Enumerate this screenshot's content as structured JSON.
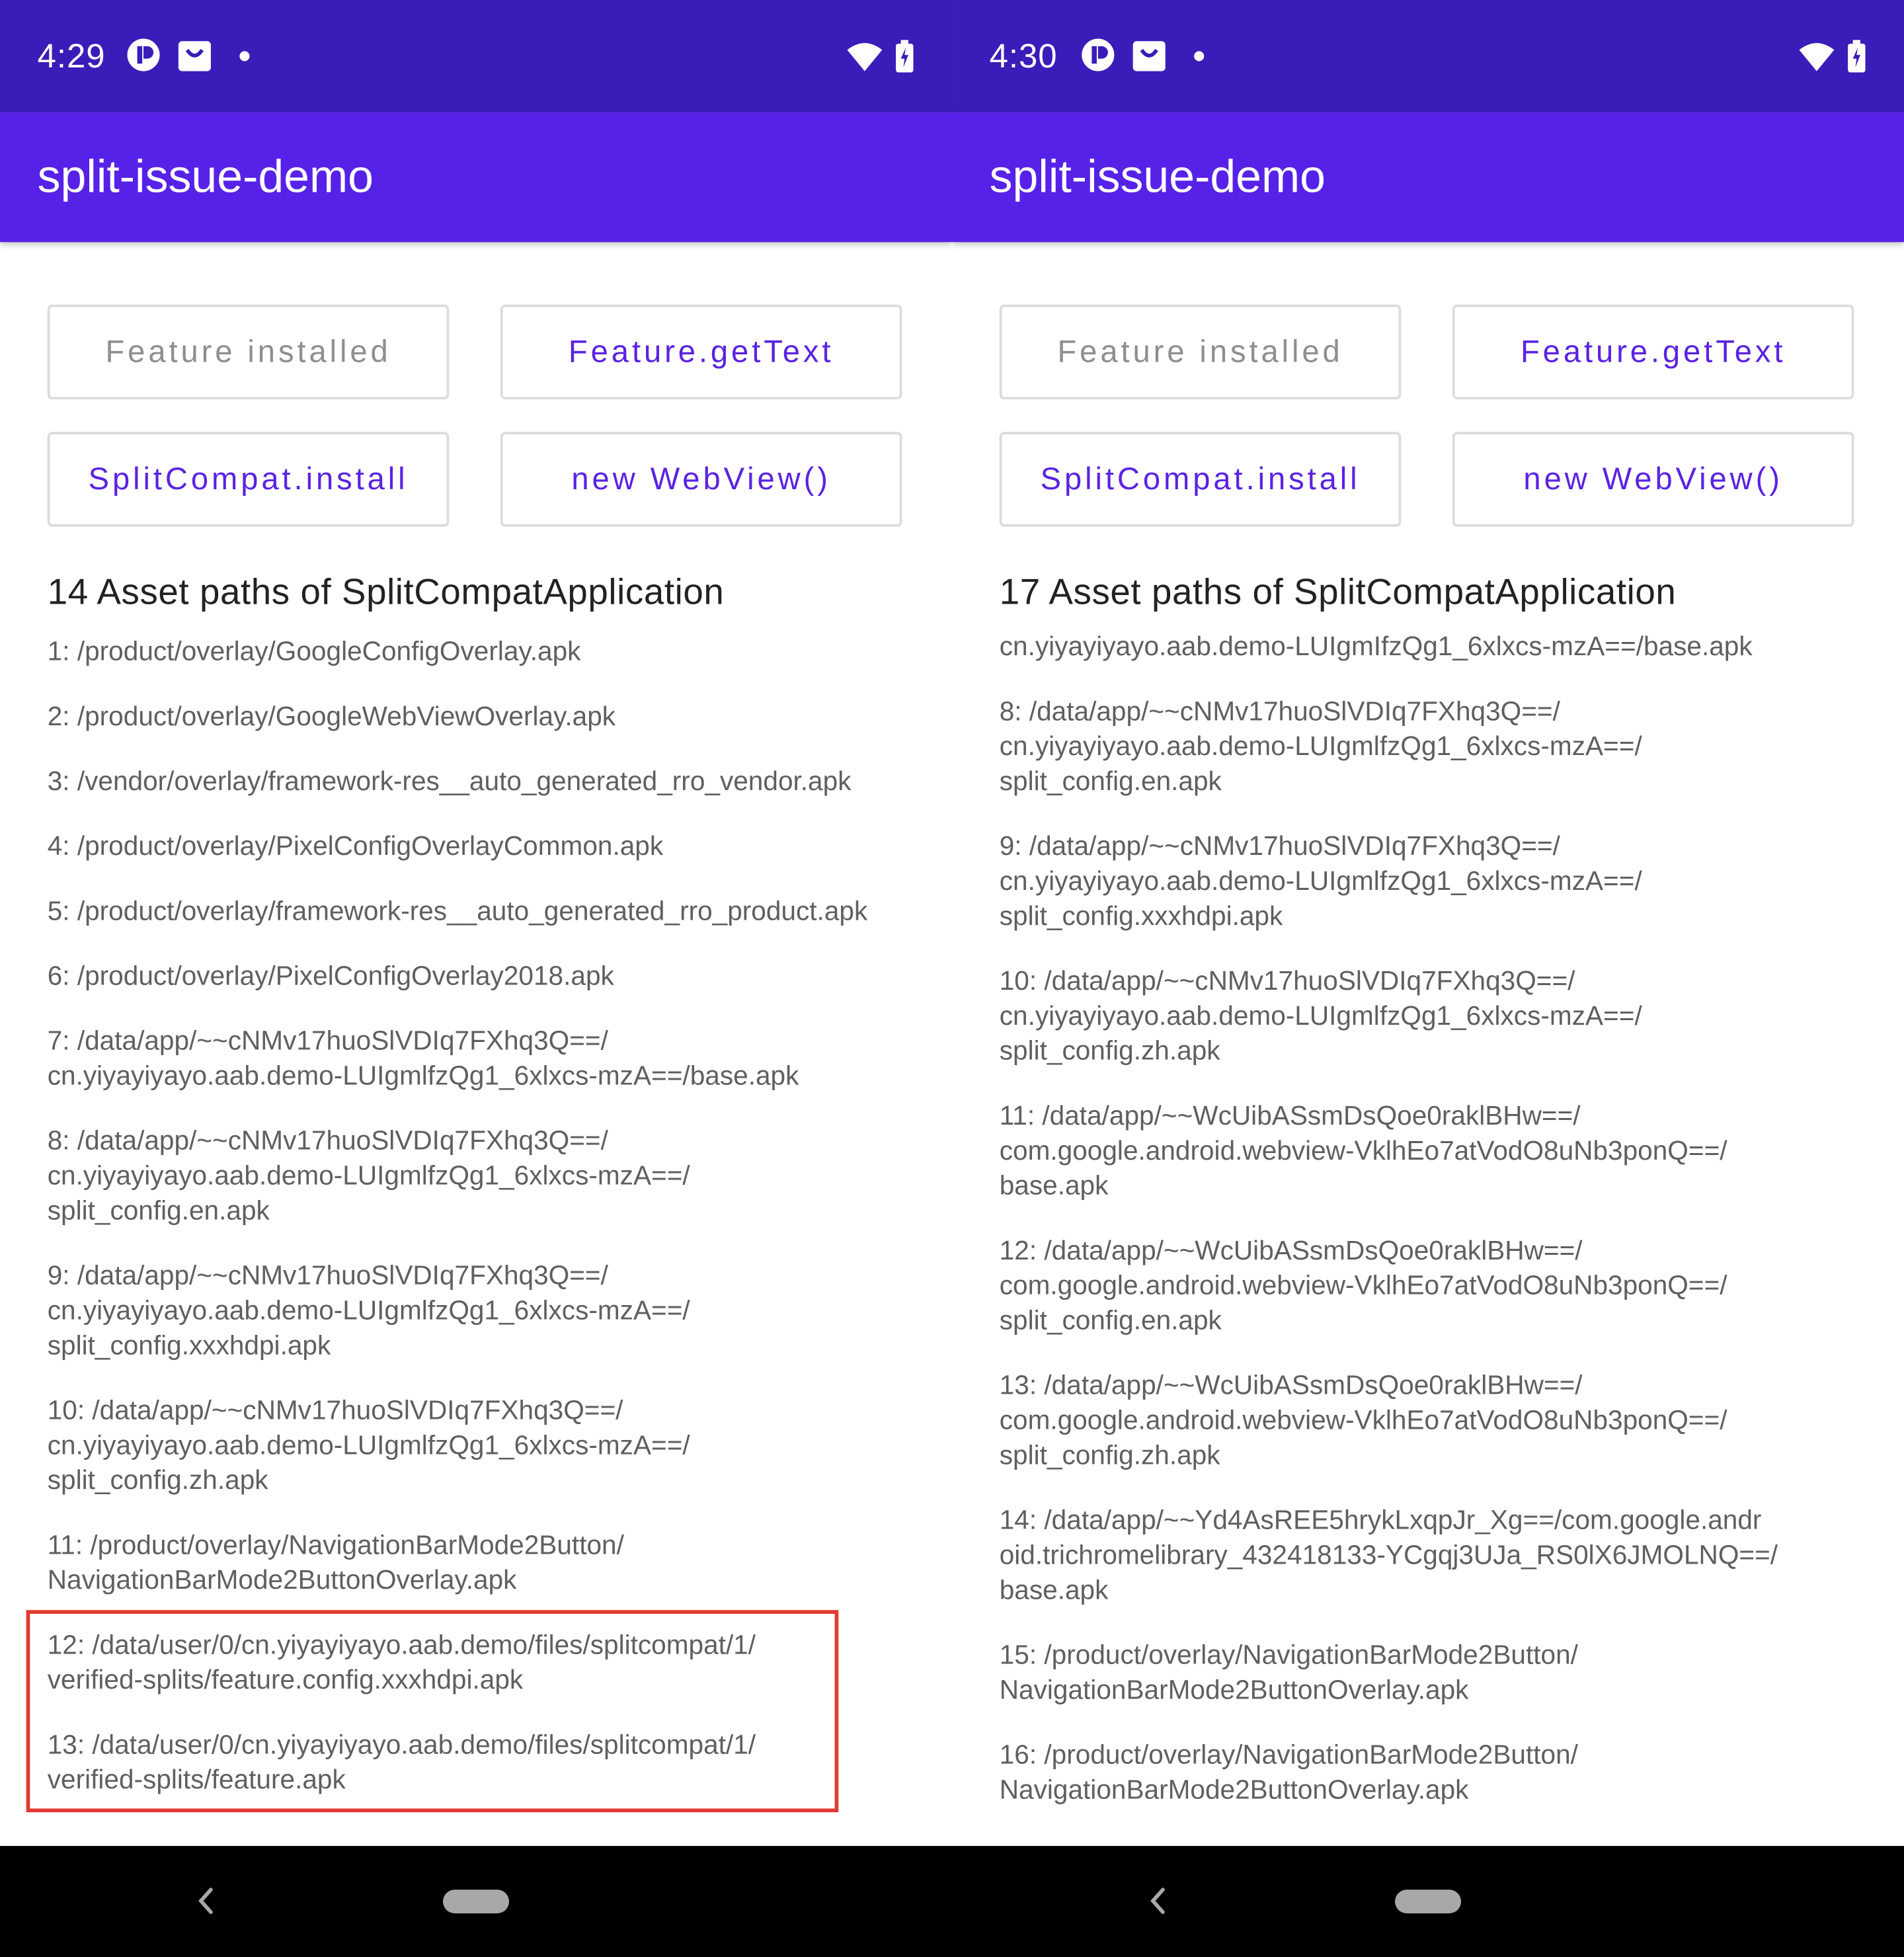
{
  "screens": [
    {
      "status_bar": {
        "time": "4:29",
        "icons": [
          "media-app-icon",
          "shopping-bag-icon",
          "notification-dot-icon",
          "wifi-icon",
          "battery-charging-icon"
        ]
      },
      "app_bar": {
        "title": "split-issue-demo"
      },
      "buttons": [
        {
          "label": "Feature installed",
          "enabled": false
        },
        {
          "label": "Feature.getText",
          "enabled": true
        },
        {
          "label": "SplitCompat.install",
          "enabled": true
        },
        {
          "label": "new WebView()",
          "enabled": true
        }
      ],
      "section_title": "14 Asset paths of SplitCompatApplication",
      "paths": [
        "1: /product/overlay/GoogleConfigOverlay.apk",
        "2: /product/overlay/GoogleWebViewOverlay.apk",
        "3: /vendor/overlay/framework-res__auto_generated_rro_vendor.apk",
        "4: /product/overlay/PixelConfigOverlayCommon.apk",
        "5: /product/overlay/framework-res__auto_generated_rro_product.apk",
        "6: /product/overlay/PixelConfigOverlay2018.apk",
        "7: /data/app/~~cNMv17huoSlVDIq7FXhq3Q==/\ncn.yiyayiyayo.aab.demo-LUIgmlfzQg1_6xlxcs-mzA==/base.apk",
        "8: /data/app/~~cNMv17huoSlVDIq7FXhq3Q==/\ncn.yiyayiyayo.aab.demo-LUIgmlfzQg1_6xlxcs-mzA==/\nsplit_config.en.apk",
        "9: /data/app/~~cNMv17huoSlVDIq7FXhq3Q==/\ncn.yiyayiyayo.aab.demo-LUIgmlfzQg1_6xlxcs-mzA==/\nsplit_config.xxxhdpi.apk",
        "10: /data/app/~~cNMv17huoSlVDIq7FXhq3Q==/\ncn.yiyayiyayo.aab.demo-LUIgmlfzQg1_6xlxcs-mzA==/\nsplit_config.zh.apk",
        "11: /product/overlay/NavigationBarMode2Button/\nNavigationBarMode2ButtonOverlay.apk",
        "12: /data/user/0/cn.yiyayiyayo.aab.demo/files/splitcompat/1/\nverified-splits/feature.config.xxxhdpi.apk",
        "13: /data/user/0/cn.yiyayiyayo.aab.demo/files/splitcompat/1/\nverified-splits/feature.apk"
      ]
    },
    {
      "status_bar": {
        "time": "4:30",
        "icons": [
          "media-app-icon",
          "shopping-bag-icon",
          "notification-dot-icon",
          "wifi-icon",
          "battery-charging-icon"
        ]
      },
      "app_bar": {
        "title": "split-issue-demo"
      },
      "buttons": [
        {
          "label": "Feature installed",
          "enabled": false
        },
        {
          "label": "Feature.getText",
          "enabled": true
        },
        {
          "label": "SplitCompat.install",
          "enabled": true
        },
        {
          "label": "new WebView()",
          "enabled": true
        }
      ],
      "section_title": "17 Asset paths of SplitCompatApplication",
      "paths": [
        "cn.yiyayiyayo.aab.demo-LUIgmIfzQg1_6xlxcs-mzA==/base.apk",
        "8: /data/app/~~cNMv17huoSlVDIq7FXhq3Q==/\ncn.yiyayiyayo.aab.demo-LUIgmlfzQg1_6xlxcs-mzA==/\nsplit_config.en.apk",
        "9: /data/app/~~cNMv17huoSlVDIq7FXhq3Q==/\ncn.yiyayiyayo.aab.demo-LUIgmlfzQg1_6xlxcs-mzA==/\nsplit_config.xxxhdpi.apk",
        "10: /data/app/~~cNMv17huoSlVDIq7FXhq3Q==/\ncn.yiyayiyayo.aab.demo-LUIgmlfzQg1_6xlxcs-mzA==/\nsplit_config.zh.apk",
        "11: /data/app/~~WcUibASsmDsQoe0raklBHw==/\ncom.google.android.webview-VklhEo7atVodO8uNb3ponQ==/\nbase.apk",
        "12: /data/app/~~WcUibASsmDsQoe0raklBHw==/\ncom.google.android.webview-VklhEo7atVodO8uNb3ponQ==/\nsplit_config.en.apk",
        "13: /data/app/~~WcUibASsmDsQoe0raklBHw==/\ncom.google.android.webview-VklhEo7atVodO8uNb3ponQ==/\nsplit_config.zh.apk",
        "14: /data/app/~~Yd4AsREE5hrykLxqpJr_Xg==/com.google.andr\noid.trichromelibrary_432418133-YCgqj3UJa_RS0lX6JMOLNQ==/\nbase.apk",
        "15: /product/overlay/NavigationBarMode2Button/\nNavigationBarMode2ButtonOverlay.apk",
        "16: /product/overlay/NavigationBarMode2Button/\nNavigationBarMode2ButtonOverlay.apk"
      ]
    }
  ],
  "colors": {
    "status_bar": "#3a1cb9",
    "app_bar": "#5722e8",
    "button_text": "#5a22e3",
    "button_disabled_text": "#8e8e8e",
    "highlight_border": "#e13a30"
  },
  "highlight": {
    "screen": 0,
    "items": [
      "12",
      "13"
    ]
  }
}
